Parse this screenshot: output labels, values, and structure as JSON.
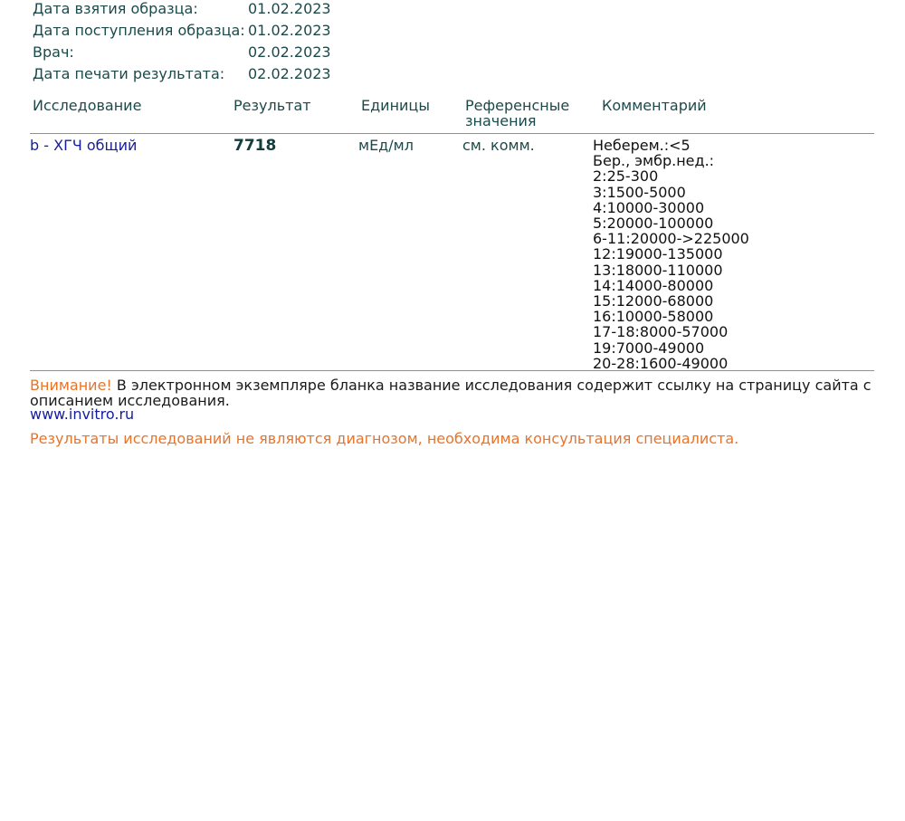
{
  "meta": [
    {
      "label": "Дата взятия образца:",
      "value": "01.02.2023"
    },
    {
      "label": "Дата поступления образца:",
      "value": "01.02.2023"
    },
    {
      "label": "Врач:",
      "value": "02.02.2023"
    },
    {
      "label": "Дата печати результата:",
      "value": "02.02.2023"
    }
  ],
  "table": {
    "headers": {
      "study": "Исследование",
      "result": "Результат",
      "units": "Единицы",
      "reference": "Референсные значения",
      "comment": "Комментарий"
    },
    "rows": [
      {
        "study": "b - ХГЧ общий",
        "result": "7718",
        "units": "мЕд/мл",
        "reference": "см. комм.",
        "comment_lines": [
          "Неберем.:<5",
          "Бер., эмбр.нед.:",
          "2:25-300",
          "3:1500-5000",
          "4:10000-30000",
          "5:20000-100000",
          "6-11:20000->225000",
          "12:19000-135000",
          "13:18000-110000",
          "14:14000-80000",
          "15:12000-68000",
          "16:10000-58000",
          "17-18:8000-57000",
          "19:7000-49000",
          "20-28:1600-49000"
        ]
      }
    ]
  },
  "notice": {
    "warning": "Внимание!",
    "text": " В электронном экземпляре бланка название исследования содержит ссылку на страницу сайта с описанием исследования."
  },
  "site_link": "www.invitro.ru",
  "disclaimer": "Результаты исследований не являются диагнозом, необходима консультация специалиста.",
  "colors": {
    "link": "#151e9a",
    "warning": "#e8742a",
    "rule": "#58a4c0",
    "text": "#1c4a4a"
  }
}
